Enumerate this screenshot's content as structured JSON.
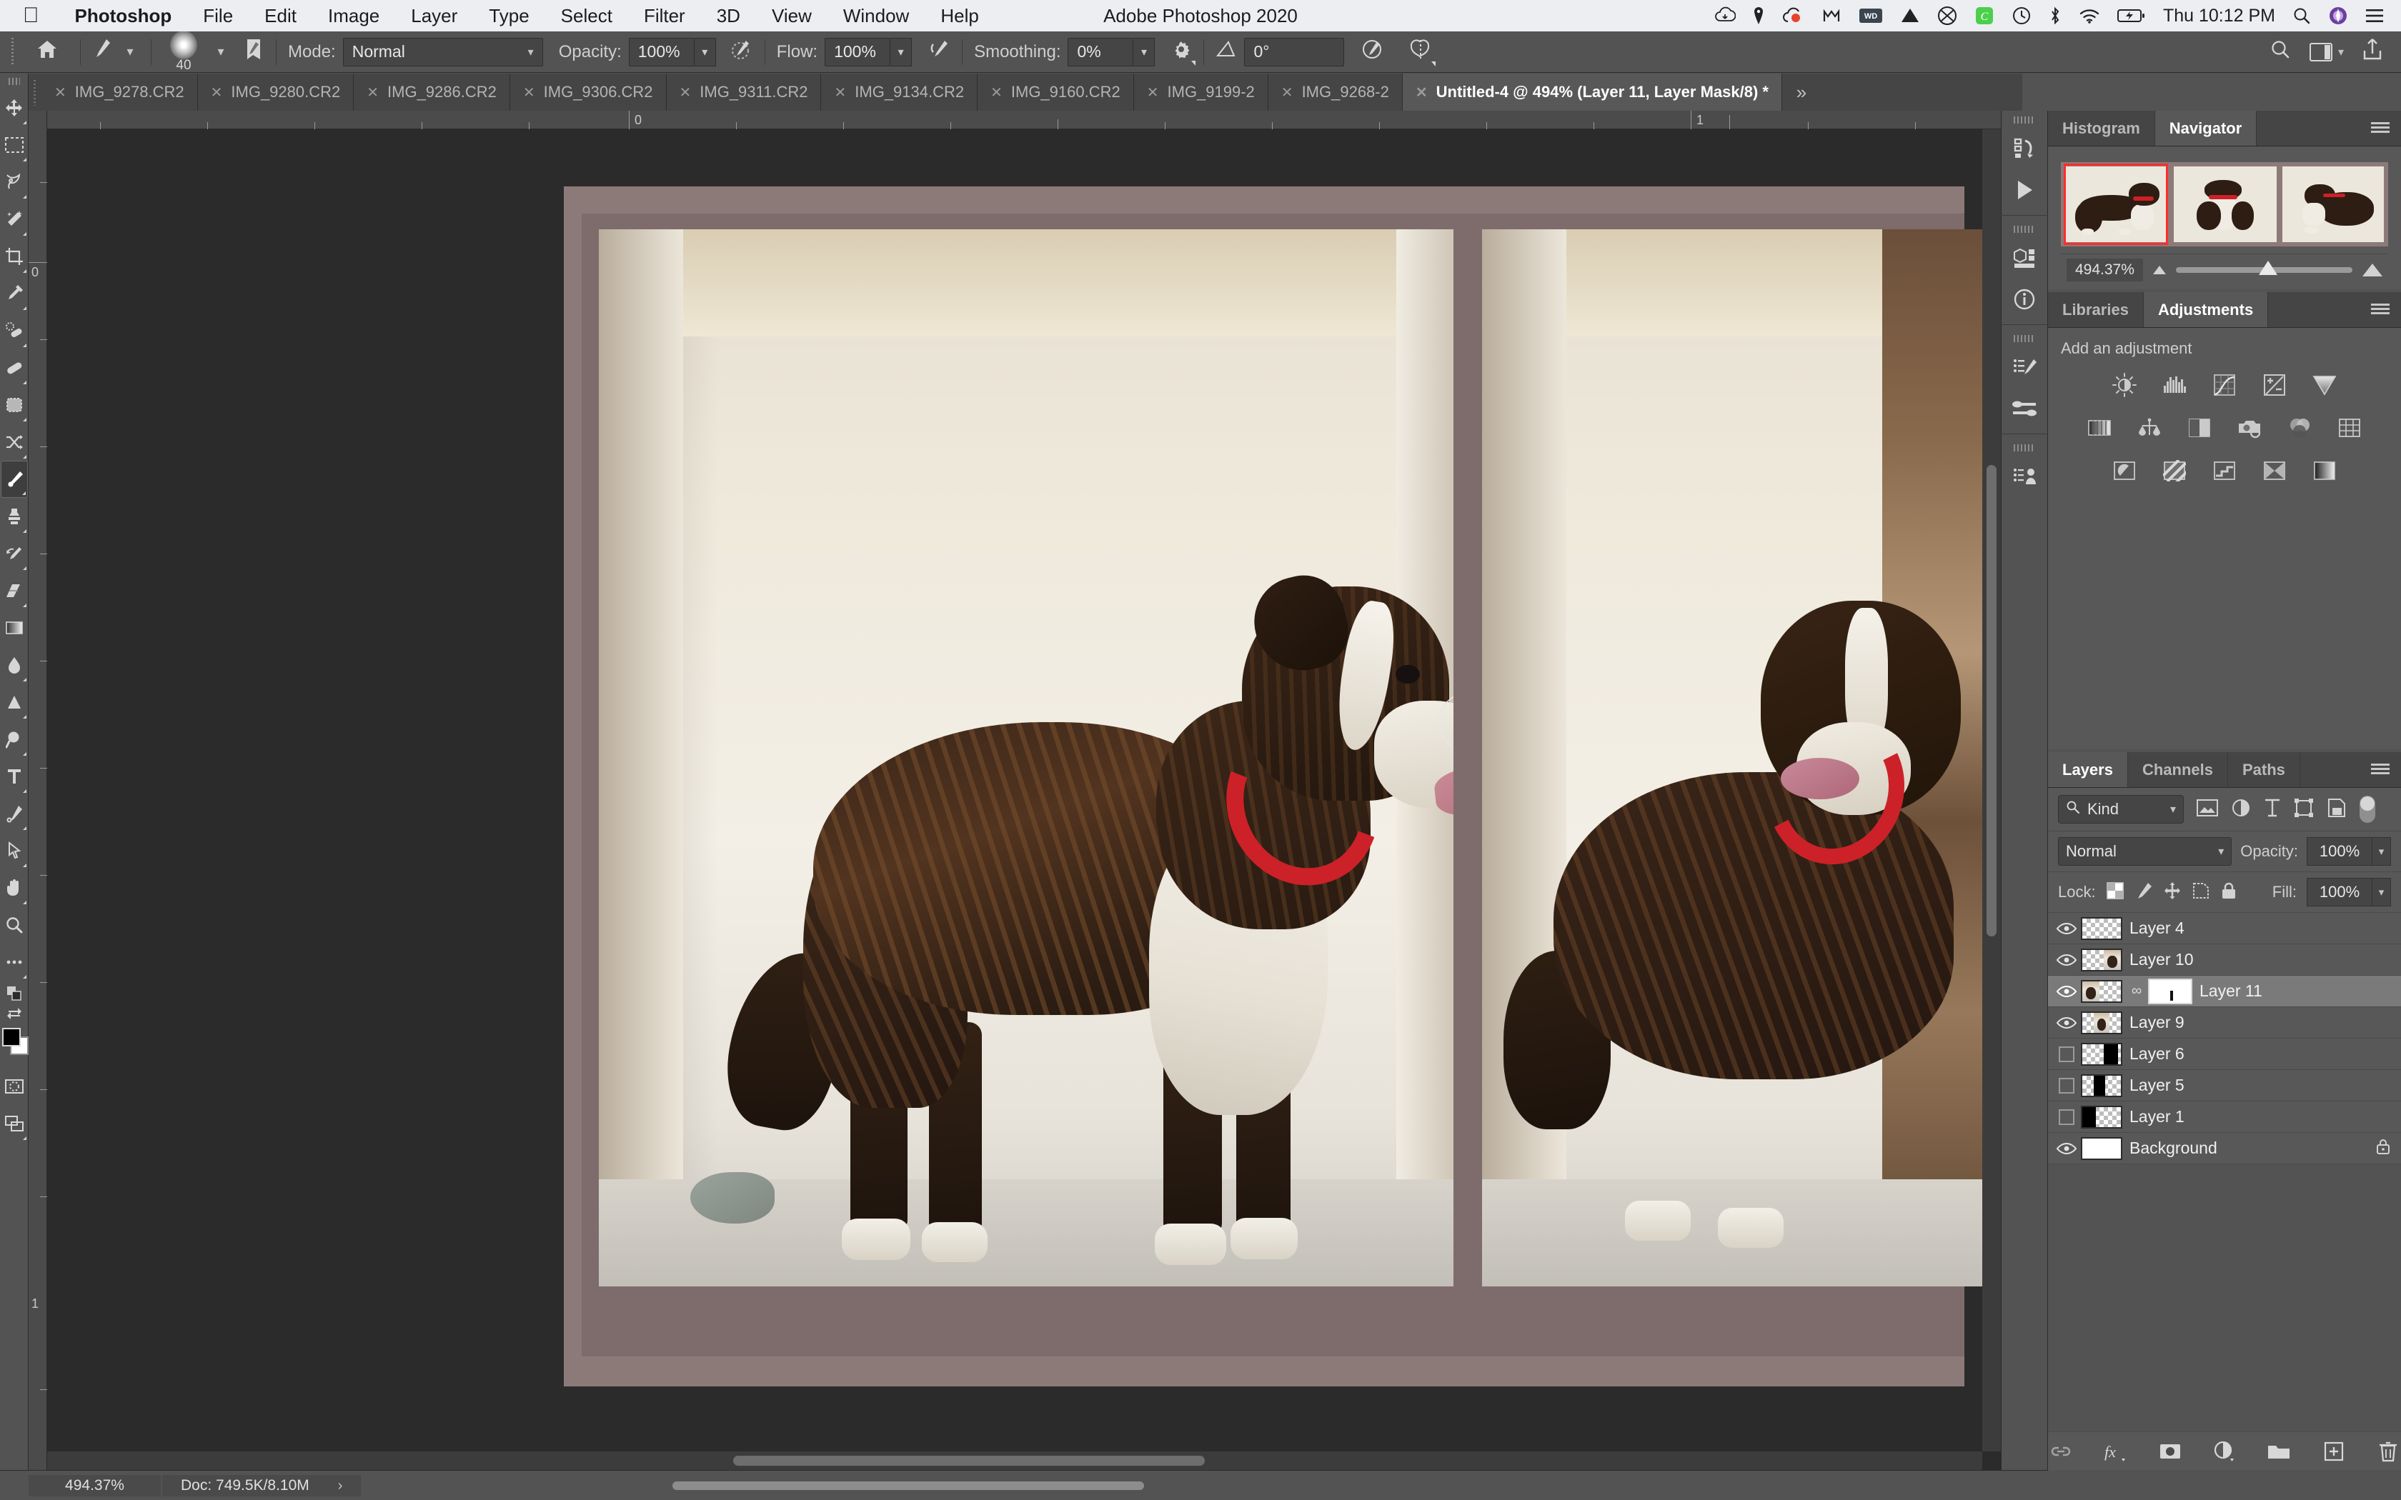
{
  "macos": {
    "apple_icon": "apple-icon",
    "menus": [
      "Photoshop",
      "File",
      "Edit",
      "Image",
      "Layer",
      "Type",
      "Select",
      "Filter",
      "3D",
      "View",
      "Window",
      "Help"
    ],
    "app_title": "Adobe Photoshop 2020",
    "clock": "Thu 10:12 PM",
    "status_icons": [
      "cloud-icon",
      "notification-icon",
      "creative-cloud-icon",
      "malwarebytes-icon",
      "wd-drive-icon",
      "dropbox-icon",
      "backblaze-icon",
      "evernote-icon",
      "timemachine-icon",
      "bluetooth-icon",
      "wifi-icon",
      "battery-charging-icon",
      "spotlight-search-icon",
      "siri-icon",
      "control-center-icon"
    ]
  },
  "options_bar": {
    "home_icon": "home-icon",
    "tool_preset_icon": "brush-preset-icon",
    "brush_size": "40",
    "brush_panel_icon": "brush-settings-icon",
    "mode_label": "Mode:",
    "mode_value": "Normal",
    "opacity_label": "Opacity:",
    "opacity_value": "100%",
    "pressure_opacity_icon": "tablet-pressure-opacity-icon",
    "flow_label": "Flow:",
    "flow_value": "100%",
    "airbrush_icon": "airbrush-icon",
    "smoothing_label": "Smoothing:",
    "smoothing_value": "0%",
    "smoothing_gear_icon": "gear-icon",
    "angle_icon": "angle-icon",
    "angle_value": "0°",
    "pressure_size_icon": "tablet-pressure-size-icon",
    "symmetry_icon": "symmetry-butterfly-icon",
    "search_icon": "search-icon",
    "workspace_icon": "workspace-icon",
    "share_icon": "share-icon"
  },
  "tabs": [
    {
      "label": "IMG_9278.CR2",
      "active": false
    },
    {
      "label": "IMG_9280.CR2",
      "active": false
    },
    {
      "label": "IMG_9286.CR2",
      "active": false
    },
    {
      "label": "IMG_9306.CR2",
      "active": false
    },
    {
      "label": "IMG_9311.CR2",
      "active": false
    },
    {
      "label": "IMG_9134.CR2",
      "active": false
    },
    {
      "label": "IMG_9160.CR2",
      "active": false
    },
    {
      "label": "IMG_9199-2",
      "active": false
    },
    {
      "label": "IMG_9268-2",
      "active": false
    },
    {
      "label": "Untitled-4 @ 494% (Layer 11, Layer Mask/8) *",
      "active": true
    }
  ],
  "tab_overflow_icon": "chevron-double-right-icon",
  "toolbar": {
    "tools": [
      {
        "name": "move-tool",
        "icon": "move-icon",
        "active": false
      },
      {
        "name": "rectangular-marquee-tool",
        "icon": "marquee-icon",
        "active": false
      },
      {
        "name": "lasso-tool",
        "icon": "lasso-icon",
        "active": false
      },
      {
        "name": "object-selection-tool",
        "icon": "magic-wand-icon",
        "active": false
      },
      {
        "name": "crop-tool",
        "icon": "crop-icon",
        "active": false
      },
      {
        "name": "eyedropper-tool",
        "icon": "eyedropper-icon",
        "active": false
      },
      {
        "name": "spot-healing-brush-tool",
        "icon": "spot-healing-icon",
        "active": false
      },
      {
        "name": "healing-brush-tool",
        "icon": "bandage-icon",
        "active": false
      },
      {
        "name": "patch-tool",
        "icon": "patch-icon",
        "active": false
      },
      {
        "name": "shuffle-tool",
        "icon": "shuffle-icon",
        "active": false
      },
      {
        "name": "brush-tool",
        "icon": "brush-icon",
        "active": true
      },
      {
        "name": "clone-stamp-tool",
        "icon": "stamp-icon",
        "active": false
      },
      {
        "name": "history-brush-tool",
        "icon": "history-brush-icon",
        "active": false
      },
      {
        "name": "eraser-tool",
        "icon": "eraser-icon",
        "active": false
      },
      {
        "name": "gradient-tool",
        "icon": "gradient-icon",
        "active": false
      },
      {
        "name": "blur-tool",
        "icon": "blur-drop-icon",
        "active": false
      },
      {
        "name": "dodge-tool",
        "icon": "dodge-icon",
        "active": false
      },
      {
        "name": "burn-tool",
        "icon": "burn-icon",
        "active": false
      },
      {
        "name": "type-tool",
        "icon": "type-icon",
        "active": false
      },
      {
        "name": "pen-tool",
        "icon": "pen-icon",
        "active": false
      },
      {
        "name": "path-selection-tool",
        "icon": "path-arrow-icon",
        "active": false
      },
      {
        "name": "hand-tool",
        "icon": "hand-icon",
        "active": false
      },
      {
        "name": "zoom-tool",
        "icon": "magnifier-icon",
        "active": false
      },
      {
        "name": "edit-toolbar-button",
        "icon": "ellipsis-icon",
        "active": false
      }
    ],
    "swap_colors_icon": "swap-colors-icon",
    "default_colors_icon": "default-colors-icon",
    "foreground_color": "#000000",
    "background_color": "#ffffff",
    "quick_mask_icon": "quick-mask-icon",
    "screen_mode_icon": "screen-mode-icon"
  },
  "canvas": {
    "ruler_labels_h": [
      "0",
      "1"
    ],
    "ruler_labels_v": [
      "0",
      "1"
    ],
    "brush_cursor_icon": "brush-cursor-circle"
  },
  "rail_icons": [
    "history-icon",
    "play-actions-icon",
    "3d-icon",
    "info-icon",
    "brush-settings-icon",
    "brush-presets-icon",
    "character-styles-icon"
  ],
  "navigator_panel": {
    "tabs": [
      {
        "label": "Histogram",
        "active": false
      },
      {
        "label": "Navigator",
        "active": true
      }
    ],
    "menu_icon": "panel-menu-icon",
    "zoom_value": "494.37%",
    "zoom_out_icon": "zoom-out-triangle-icon",
    "zoom_in_icon": "zoom-in-triangle-icon",
    "view_box_color": "#ff2d2d"
  },
  "adjustments_panel": {
    "tabs": [
      {
        "label": "Libraries",
        "active": false
      },
      {
        "label": "Adjustments",
        "active": true
      }
    ],
    "menu_icon": "panel-menu-icon",
    "title": "Add an adjustment",
    "icons_row1": [
      "brightness-contrast-icon",
      "levels-icon",
      "curves-icon",
      "exposure-icon",
      "vibrance-icon"
    ],
    "icons_row2": [
      "hue-saturation-icon",
      "color-balance-icon",
      "black-white-icon",
      "photo-filter-icon",
      "channel-mixer-icon",
      "color-lookup-icon"
    ],
    "icons_row3": [
      "invert-icon",
      "posterize-icon",
      "threshold-icon",
      "selective-color-icon",
      "gradient-map-icon"
    ]
  },
  "layers_panel": {
    "tabs": [
      {
        "label": "Layers",
        "active": true
      },
      {
        "label": "Channels",
        "active": false
      },
      {
        "label": "Paths",
        "active": false
      }
    ],
    "menu_icon": "panel-menu-icon",
    "filter_kind": "Kind",
    "filter_search_icon": "search-icon",
    "filter_icons": [
      "filter-pixel-icon",
      "filter-adjustment-icon",
      "filter-type-icon",
      "filter-shape-icon",
      "filter-smart-object-icon"
    ],
    "filter_toggle_icon": "filter-enable-toggle",
    "blend_mode": "Normal",
    "opacity_label": "Opacity:",
    "opacity_value": "100%",
    "lock_label": "Lock:",
    "lock_icons": [
      "lock-transparent-pixels-icon",
      "lock-image-pixels-icon",
      "lock-position-icon",
      "lock-artboard-icon",
      "lock-all-icon"
    ],
    "fill_label": "Fill:",
    "fill_value": "100%",
    "layers": [
      {
        "name": "Layer 4",
        "visible": true,
        "selected": false,
        "thumb": "empty",
        "has_mask": false,
        "locked": false
      },
      {
        "name": "Layer 10",
        "visible": true,
        "selected": false,
        "thumb": "photo-right",
        "has_mask": false,
        "locked": false
      },
      {
        "name": "Layer 11",
        "visible": true,
        "selected": true,
        "thumb": "photo-left",
        "has_mask": true,
        "locked": false
      },
      {
        "name": "Layer 9",
        "visible": true,
        "selected": false,
        "thumb": "photo-center",
        "has_mask": false,
        "locked": false
      },
      {
        "name": "Layer 6",
        "visible": false,
        "selected": false,
        "thumb": "black-right",
        "has_mask": false,
        "locked": false
      },
      {
        "name": "Layer 5",
        "visible": false,
        "selected": false,
        "thumb": "black-center",
        "has_mask": false,
        "locked": false
      },
      {
        "name": "Layer 1",
        "visible": false,
        "selected": false,
        "thumb": "black-left",
        "has_mask": false,
        "locked": false
      },
      {
        "name": "Background",
        "visible": true,
        "selected": false,
        "thumb": "white",
        "has_mask": false,
        "locked": true
      }
    ],
    "footer_icons": [
      "link-layers-icon",
      "layer-styles-fx-icon",
      "add-layer-mask-icon",
      "new-adjustment-layer-icon",
      "new-group-icon",
      "new-layer-icon",
      "delete-layer-icon"
    ]
  },
  "status_bar": {
    "zoom": "494.37%",
    "doc_info": "Doc: 749.5K/8.10M",
    "expand_icon": "chevron-right-icon"
  }
}
